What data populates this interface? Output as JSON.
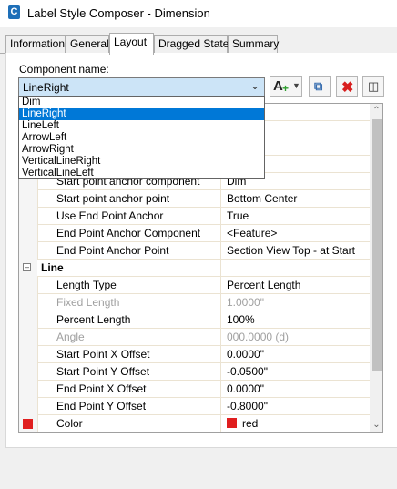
{
  "window": {
    "title": "Label Style Composer - Dimension",
    "app_icon_letter": "C"
  },
  "tabs": [
    {
      "label": "Information",
      "active": false
    },
    {
      "label": "General",
      "active": false
    },
    {
      "label": "Layout",
      "active": true
    },
    {
      "label": "Dragged State",
      "active": false
    },
    {
      "label": "Summary",
      "active": false
    }
  ],
  "component": {
    "label": "Component name:",
    "selected": "LineRight",
    "options": [
      "Dim",
      "LineRight",
      "LineLeft",
      "ArrowLeft",
      "ArrowRight",
      "VerticalLineRight",
      "VerticalLineLeft"
    ],
    "selected_index": 1
  },
  "toolbar": {
    "add_icon": "add-component-icon",
    "copy_icon": "copy-component-icon",
    "delete_icon": "delete-icon",
    "order_icon": "component-draw-order-icon"
  },
  "properties": {
    "partial_row_value": "nt",
    "rows": [
      {
        "name": "Start point anchor component",
        "value": "Dim"
      },
      {
        "name": "Start point anchor point",
        "value": "Bottom Center"
      },
      {
        "name": "Use End Point Anchor",
        "value": "True"
      },
      {
        "name": "End Point Anchor Component",
        "value": "<Feature>"
      },
      {
        "name": "End Point Anchor Point",
        "value": "Section View Top - at Start"
      }
    ],
    "line_category": "Line",
    "line_rows": [
      {
        "name": "Length Type",
        "value": "Percent Length",
        "disabled": false
      },
      {
        "name": "Fixed Length",
        "value": "1.0000\"",
        "disabled": true
      },
      {
        "name": "Percent Length",
        "value": "100%",
        "disabled": false
      },
      {
        "name": "Angle",
        "value": "000.0000 (d)",
        "disabled": true
      },
      {
        "name": "Start Point X Offset",
        "value": "0.0000\"",
        "disabled": false
      },
      {
        "name": "Start Point Y Offset",
        "value": "-0.0500\"",
        "disabled": false
      },
      {
        "name": "End Point X Offset",
        "value": "0.0000\"",
        "disabled": false
      },
      {
        "name": "End Point Y Offset",
        "value": "-0.8000\"",
        "disabled": false
      }
    ],
    "color_row": {
      "name": "Color",
      "value": "red",
      "swatch_color": "#e01e1e"
    }
  },
  "colors": {
    "selection": "#0078d7",
    "combo_bg": "#cce4f7",
    "delete_red": "#d81e1e"
  }
}
